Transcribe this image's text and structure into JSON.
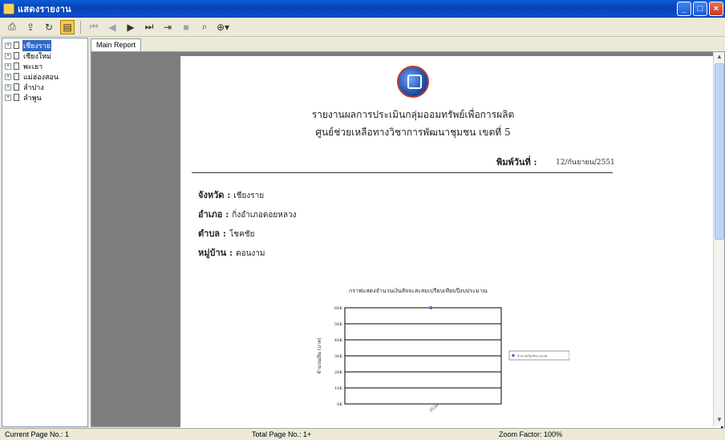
{
  "window": {
    "title": "แสดงรายงาน"
  },
  "toolbar": {
    "buttons": [
      "print-icon",
      "export-icon",
      "refresh-icon",
      "tree-toggle-icon",
      "first-page-icon",
      "prev-page-icon",
      "next-page-icon",
      "last-page-icon",
      "goto-page-icon",
      "stop-icon",
      "search-icon",
      "zoom-icon"
    ]
  },
  "tree": {
    "items": [
      {
        "label": "เชียงราย",
        "selected": true
      },
      {
        "label": "เชียงใหม่",
        "selected": false
      },
      {
        "label": "พะเยา",
        "selected": false
      },
      {
        "label": "แม่ฮ่องสอน",
        "selected": false
      },
      {
        "label": "ลำปาง",
        "selected": false
      },
      {
        "label": "ลำพูน",
        "selected": false
      }
    ]
  },
  "tab": {
    "label": "Main Report"
  },
  "report": {
    "title1": "รายงานผลการประเมินกลุ่มออมทรัพย์เพื่อการผลิต",
    "title2": "ศูนย์ช่วยเหลือทางวิชาการพัฒนาชุมชน เขตที่ 5",
    "print_label": "พิมพ์วันที่ :",
    "print_date": "12/กันยายน/2551",
    "fields": [
      {
        "key": "จังหวัด :",
        "value": "เชียงราย"
      },
      {
        "key": "อำเภอ :",
        "value": "กิ่งอำเภอดอยหลวง"
      },
      {
        "key": "ตำบล :",
        "value": "โชคชัย"
      },
      {
        "key": "หมู่บ้าน :",
        "value": "ดอนงาม"
      }
    ]
  },
  "chart_data": {
    "type": "line",
    "title": "กราฟแสดงจำนวนเงินสัจจะสะสมเปรียบเทียบปีงบประมาณ",
    "ylabel": "จำนวนเงิน (บาท)",
    "categories": [
      "2550"
    ],
    "series": [
      {
        "name": "จำนวนเงินสัจจะสะสม",
        "values": [
          60000
        ]
      }
    ],
    "yticks": [
      "0K",
      "10K",
      "20K",
      "30K",
      "40K",
      "50K",
      "60K"
    ],
    "ylim": [
      0,
      60000
    ],
    "legend": "right",
    "grid": true,
    "colors": {
      "series": "#4a6fb5"
    }
  },
  "status": {
    "current_page": "Current Page No.: 1",
    "total_page": "Total Page No.: 1+",
    "zoom": "Zoom Factor: 100%"
  }
}
